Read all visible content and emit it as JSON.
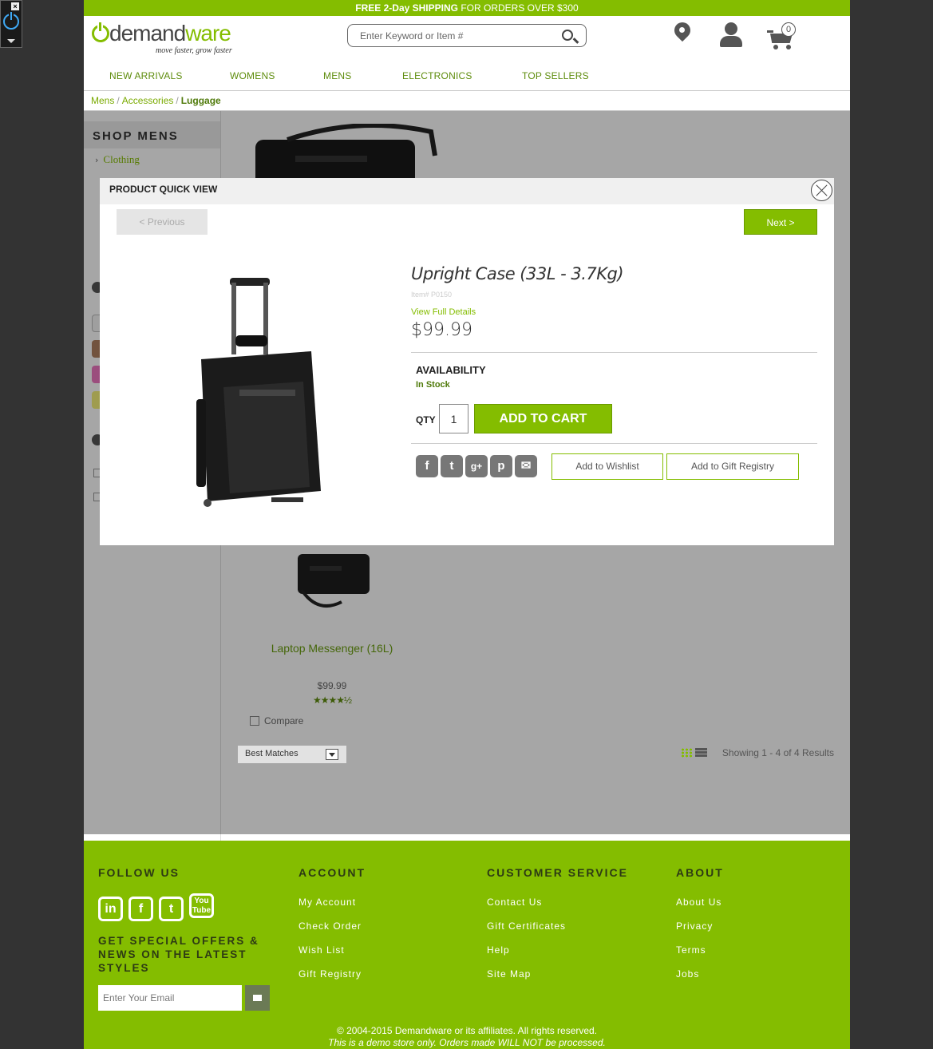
{
  "promo": {
    "bold": "FREE 2-Day SHIPPING",
    "rest": " FOR ORDERS OVER $300"
  },
  "logo": {
    "brand_a": "demand",
    "brand_b": "ware",
    "tagline": "move faster, grow faster"
  },
  "search": {
    "placeholder": "Enter Keyword or Item #"
  },
  "cart": {
    "count": "0"
  },
  "nav": [
    "NEW ARRIVALS",
    "WOMENS",
    "MENS",
    "ELECTRONICS",
    "TOP SELLERS"
  ],
  "breadcrumb": [
    "Mens",
    "Accessories",
    "Luggage"
  ],
  "sidebar": {
    "heading": "SHOP MENS",
    "items": [
      "Clothing"
    ]
  },
  "product_card": {
    "name": "Laptop Messenger (16L)",
    "price": "$99.99",
    "stars": "★★★★½",
    "compare": "Compare"
  },
  "sort": {
    "selected": "Best Matches"
  },
  "results": "Showing 1 - 4 of 4 Results",
  "quickview": {
    "header": "PRODUCT QUICK VIEW",
    "prev": "< Previous",
    "next": "Next >",
    "title": "Upright Case (33L - 3.7Kg)",
    "item_no": "Item# P0150",
    "details_link": "View Full Details",
    "price": "$99.99",
    "availability_label": "AVAILABILITY",
    "availability_value": "In Stock",
    "qty_label": "QTY",
    "qty": "1",
    "add_to_cart": "ADD TO CART",
    "share_icons": [
      "facebook-icon",
      "twitter-icon",
      "google-plus-icon",
      "pinterest-icon",
      "email-icon"
    ],
    "wishlist": "Add to Wishlist",
    "gift_registry": "Add to Gift Registry"
  },
  "footer": {
    "follow": "FOLLOW US",
    "social_icons": [
      "linkedin-icon",
      "facebook-icon",
      "twitter-icon",
      "youtube-icon"
    ],
    "offers": "GET SPECIAL OFFERS & NEWS ON THE LATEST STYLES",
    "email_placeholder": "Enter Your Email",
    "account": {
      "title": "ACCOUNT",
      "links": [
        "My Account",
        "Check Order",
        "Wish List",
        "Gift Registry"
      ]
    },
    "service": {
      "title": "CUSTOMER SERVICE",
      "links": [
        "Contact Us",
        "Gift Certificates",
        "Help",
        "Site Map"
      ]
    },
    "about": {
      "title": "ABOUT",
      "links": [
        "About Us",
        "Privacy",
        "Terms",
        "Jobs"
      ]
    },
    "copyright": "© 2004-2015 Demandware or its affiliates. All rights reserved.",
    "disclaimer": "This is a demo store only. Orders made WILL NOT be processed."
  },
  "colors": {
    "brand_green": "#84bd00",
    "dark_green": "#4f7a0a"
  }
}
